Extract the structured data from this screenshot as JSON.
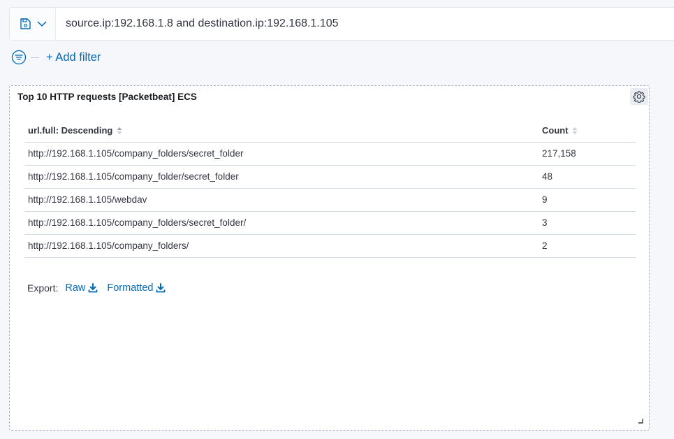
{
  "query": {
    "text": "source.ip:192.168.1.8 and destination.ip:192.168.1.105"
  },
  "filters": {
    "add_label": "+ Add filter"
  },
  "panel": {
    "title": "Top 10 HTTP requests [Packetbeat] ECS",
    "columns": [
      {
        "label": "url.full: Descending"
      },
      {
        "label": "Count"
      }
    ],
    "rows": [
      {
        "url": "http://192.168.1.105/company_folders/secret_folder",
        "count": "217,158"
      },
      {
        "url": "http://192.168.1.105/company_folder/secret_folder",
        "count": "48"
      },
      {
        "url": "http://192.168.1.105/webdav",
        "count": "9"
      },
      {
        "url": "http://192.168.1.105/company_folders/secret_folder/",
        "count": "3"
      },
      {
        "url": "http://192.168.1.105/company_folders/",
        "count": "2"
      }
    ],
    "export": {
      "label": "Export:",
      "raw": "Raw",
      "formatted": "Formatted"
    }
  },
  "colors": {
    "link": "#006bb8",
    "text": "#343741"
  },
  "icons": {
    "saved_query": "save-icon",
    "chevron": "chevron-down-icon",
    "filter": "filter-icon",
    "gear": "gear-icon",
    "sort": "sort-icon",
    "download": "download-icon",
    "resize": "resize-icon"
  }
}
